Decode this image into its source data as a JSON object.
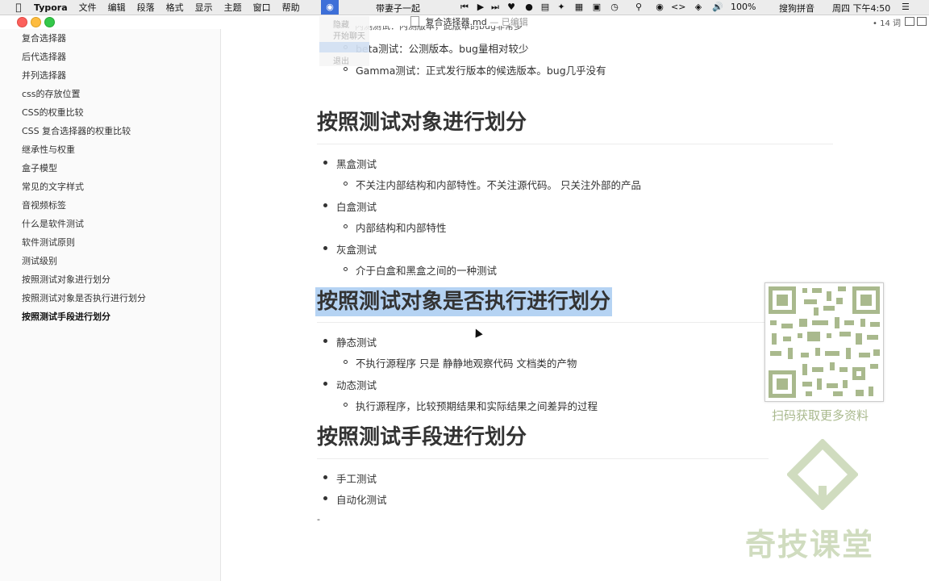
{
  "menubar": {
    "app_name": "Typora",
    "items": [
      "文件",
      "编辑",
      "段落",
      "格式",
      "显示",
      "主题",
      "窗口",
      "帮助"
    ],
    "now_playing": "带妻子一起",
    "battery": "100%",
    "ime": "搜狗拼音",
    "clock": "周四 下午4:50"
  },
  "window": {
    "title": "复合选择器.md",
    "title_status": "— 已编辑",
    "word_count": "• 14 词"
  },
  "ghost_menu": [
    "隐藏",
    "开始聊天",
    "退出"
  ],
  "sidebar": {
    "items": [
      {
        "label": "复合选择器"
      },
      {
        "label": "后代选择器"
      },
      {
        "label": "并列选择器"
      },
      {
        "label": "css的存放位置"
      },
      {
        "label": "CSS的权重比较"
      },
      {
        "label": "CSS 复合选择器的权重比较"
      },
      {
        "label": "继承性与权重"
      },
      {
        "label": "盒子模型"
      },
      {
        "label": "常见的文字样式"
      },
      {
        "label": "音视频标签"
      },
      {
        "label": "什么是软件测试"
      },
      {
        "label": "软件测试原则"
      },
      {
        "label": "测试级别"
      },
      {
        "label": "按照测试对象进行划分"
      },
      {
        "label": "按照测试对象是否执行进行划分"
      },
      {
        "label": "按照测试手段进行划分"
      }
    ]
  },
  "document": {
    "top_partial": "内测测试：内测版本，此版本的bug非常多",
    "top_items": [
      "beta测试：公测版本。bug量相对较少",
      "Gamma测试：正式发行版本的候选版本。bug几乎没有"
    ],
    "sections": [
      {
        "heading": "按照测试对象进行划分",
        "items": [
          {
            "label": "黑盒测试",
            "sub": "不关注内部结构和内部特性。不关注源代码。 只关注外部的产品"
          },
          {
            "label": "白盒测试",
            "sub": "内部结构和内部特性"
          },
          {
            "label": "灰盒测试",
            "sub": "介于白盒和黑盒之间的一种测试"
          }
        ]
      },
      {
        "heading": "按照测试对象是否执行进行划分",
        "items": [
          {
            "label": "静态测试",
            "sub": "不执行源程序 只是 静静地观察代码 文档类的产物"
          },
          {
            "label": "动态测试",
            "sub": "执行源程序，比较预期结果和实际结果之间差异的过程"
          }
        ]
      },
      {
        "heading": "按照测试手段进行划分",
        "items": [
          {
            "label": "手工测试"
          },
          {
            "label": "自动化测试"
          }
        ]
      }
    ],
    "trailing": "-"
  },
  "overlay": {
    "qr_caption": "扫码获取更多资料",
    "watermark": "奇技课堂"
  },
  "colors": {
    "highlight": "#b5d3f3",
    "watermark": "#c8d6b4",
    "qr_green": "#a9b98d"
  }
}
